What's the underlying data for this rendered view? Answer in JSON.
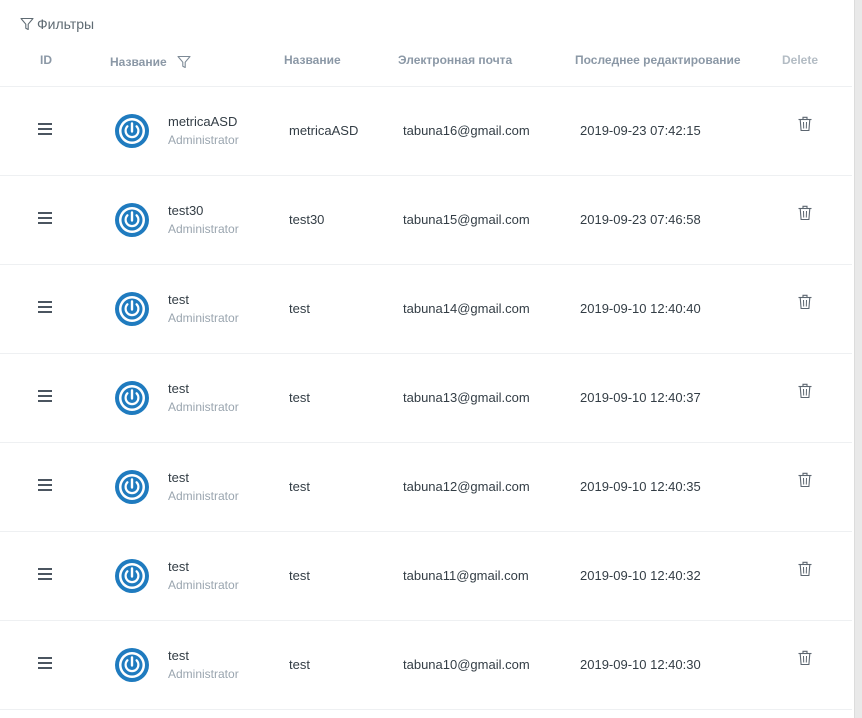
{
  "filters": {
    "label": "Фильтры"
  },
  "table": {
    "headers": {
      "id": "ID",
      "name": "Название",
      "name2": "Название",
      "email": "Электронная почта",
      "edited": "Последнее редактирование",
      "delete": "Delete"
    },
    "rows": [
      {
        "username": "metricaASD",
        "role": "Administrator",
        "name": "metricaASD",
        "email": "tabuna16@gmail.com",
        "edited": "2019-09-23 07:42:15"
      },
      {
        "username": "test30",
        "role": "Administrator",
        "name": "test30",
        "email": "tabuna15@gmail.com",
        "edited": "2019-09-23 07:46:58"
      },
      {
        "username": "test",
        "role": "Administrator",
        "name": "test",
        "email": "tabuna14@gmail.com",
        "edited": "2019-09-10 12:40:40"
      },
      {
        "username": "test",
        "role": "Administrator",
        "name": "test",
        "email": "tabuna13@gmail.com",
        "edited": "2019-09-10 12:40:37"
      },
      {
        "username": "test",
        "role": "Administrator",
        "name": "test",
        "email": "tabuna12@gmail.com",
        "edited": "2019-09-10 12:40:35"
      },
      {
        "username": "test",
        "role": "Administrator",
        "name": "test",
        "email": "tabuna11@gmail.com",
        "edited": "2019-09-10 12:40:32"
      },
      {
        "username": "test",
        "role": "Administrator",
        "name": "test",
        "email": "tabuna10@gmail.com",
        "edited": "2019-09-10 12:40:30"
      }
    ]
  },
  "icons": {
    "filter": "filter-icon",
    "drag": "drag-handle-icon",
    "avatar": "power-icon",
    "delete": "trash-icon"
  },
  "colors": {
    "avatar": "#1f7bbf",
    "header_text": "#8b98a6",
    "muted": "#9aa5af"
  }
}
